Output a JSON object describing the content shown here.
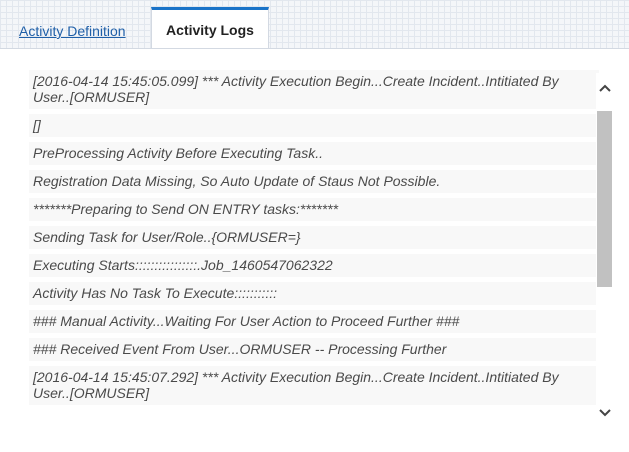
{
  "tabs": {
    "definition_label": "Activity Definition",
    "logs_label": "Activity Logs"
  },
  "logs": [
    "[2016-04-14 15:45:05.099] *** Activity Execution Begin...Create Incident..Intitiated By User..[ORMUSER]",
    "[]",
    "PreProcessing Activity Before Executing Task..",
    "Registration Data Missing, So Auto Update of Staus Not Possible.",
    "*******Preparing to Send ON ENTRY tasks:*******",
    "Sending Task for User/Role..{ORMUSER=}",
    "Executing Starts::::::::::::::::.Job_1460547062322",
    "Activity Has No Task To Execute:::::::::::",
    "### Manual Activity...Waiting For User Action to Proceed Further ###",
    "### Received Event From User...ORMUSER -- Processing Further",
    "[2016-04-14 15:45:07.292] *** Activity Execution Begin...Create Incident..Intitiated By User..[ORMUSER]"
  ],
  "icons": {
    "scroll_up": "chevron-up-icon",
    "scroll_down": "chevron-down-icon"
  },
  "colors": {
    "accent": "#1a73c8",
    "link": "#1f5fa8",
    "log_text": "#4a4a4a",
    "scroll_thumb": "#c1c1c1"
  }
}
